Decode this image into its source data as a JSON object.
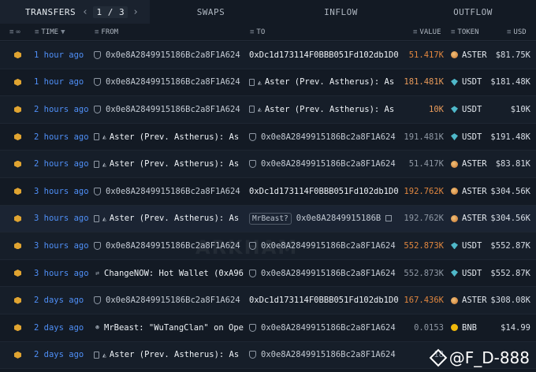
{
  "tabs": {
    "transfers": "TRANSFERS",
    "page_current": "1",
    "page_sep": "/",
    "page_total": "3",
    "swaps": "SWAPS",
    "inflow": "INFLOW",
    "outflow": "OUTFLOW"
  },
  "header": {
    "time": "TIME",
    "from": "FROM",
    "to": "TO",
    "value": "VALUE",
    "token": "TOKEN",
    "usd": "USD"
  },
  "rows": [
    {
      "time": "1 hour ago",
      "from": "0x0e8A2849915186Bc2a8F1A624",
      "to": "0xDc1d173114F0BBB051Fd102db1D0",
      "value": "51.417K",
      "token": "ASTER",
      "usd": "$81.75K"
    },
    {
      "time": "1 hour ago",
      "from": "0x0e8A2849915186Bc2a8F1A624",
      "to": "Aster (Prev. Astherus): As",
      "value": "181.481K",
      "token": "USDT",
      "usd": "$181.48K"
    },
    {
      "time": "2 hours ago",
      "from": "0x0e8A2849915186Bc2a8F1A624",
      "to": "Aster (Prev. Astherus): As",
      "value": "10K",
      "token": "USDT",
      "usd": "$10K"
    },
    {
      "time": "2 hours ago",
      "from": "Aster (Prev. Astherus): As",
      "to": "0x0e8A2849915186Bc2a8F1A624",
      "value": "191.481K",
      "token": "USDT",
      "usd": "$191.48K"
    },
    {
      "time": "2 hours ago",
      "from": "Aster (Prev. Astherus): As",
      "to": "0x0e8A2849915186Bc2a8F1A624",
      "value": "51.417K",
      "token": "ASTER",
      "usd": "$83.81K"
    },
    {
      "time": "3 hours ago",
      "from": "0x0e8A2849915186Bc2a8F1A624",
      "to": "0xDc1d173114F0BBB051Fd102db1D0",
      "value": "192.762K",
      "token": "ASTER",
      "usd": "$304.56K"
    },
    {
      "time": "3 hours ago",
      "from": "Aster (Prev. Astherus): As",
      "to_tag": "MrBeast?",
      "to": "0x0e8A2849915186B",
      "value": "192.762K",
      "token": "ASTER",
      "usd": "$304.56K"
    },
    {
      "time": "3 hours ago",
      "from": "0x0e8A2849915186Bc2a8F1A624",
      "to": "0x0e8A2849915186Bc2a8F1A624",
      "value": "552.873K",
      "token": "USDT",
      "usd": "$552.87K"
    },
    {
      "time": "3 hours ago",
      "from": "ChangeNOW: Hot Wallet (0xA96)",
      "to": "0x0e8A2849915186Bc2a8F1A624",
      "value": "552.873K",
      "token": "USDT",
      "usd": "$552.87K"
    },
    {
      "time": "2 days ago",
      "from": "0x0e8A2849915186Bc2a8F1A624",
      "to": "0xDc1d173114F0BBB051Fd102db1D0",
      "value": "167.436K",
      "token": "ASTER",
      "usd": "$308.08K"
    },
    {
      "time": "2 days ago",
      "from": "MrBeast: \"WuTangClan\" on Ope",
      "to": "0x0e8A2849915186Bc2a8F1A624",
      "value": "0.0153",
      "token": "BNB",
      "usd": "$14.99"
    },
    {
      "time": "2 days ago",
      "from": "Aster (Prev. Astherus): As",
      "to": "0x0e8A2849915186Bc2a8F1A624",
      "value": "18",
      "token": "",
      "usd": ""
    }
  ],
  "watermark": "ARKHAM",
  "credit": "@F_D-888"
}
